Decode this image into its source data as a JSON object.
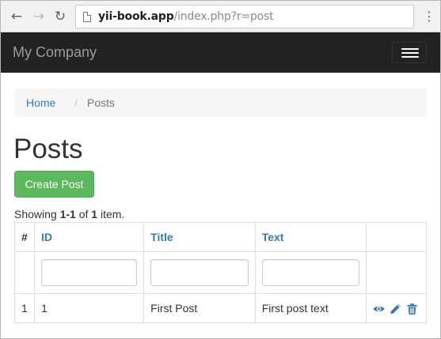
{
  "browser": {
    "url_host": "yii-book.app",
    "url_path": "/index.php?r=post",
    "back_icon": "arrow-left-icon",
    "forward_icon": "arrow-right-icon",
    "reload_icon": "reload-icon",
    "menu_icon": "kebab-menu-icon"
  },
  "navbar": {
    "brand": "My Company",
    "toggle_icon": "hamburger-menu-icon"
  },
  "breadcrumb": {
    "home": "Home",
    "separator": "/",
    "current": "Posts"
  },
  "page": {
    "title": "Posts",
    "create_button": "Create Post"
  },
  "summary": {
    "prefix": "Showing ",
    "range": "1-1",
    "middle": " of ",
    "total": "1",
    "suffix": " item."
  },
  "grid": {
    "columns": [
      "#",
      "ID",
      "Title",
      "Text"
    ],
    "filters": [
      {
        "value": "",
        "placeholder": ""
      },
      {
        "value": "",
        "placeholder": ""
      },
      {
        "value": "",
        "placeholder": ""
      }
    ],
    "rows": [
      {
        "serial": "1",
        "id": "1",
        "title": "First Post",
        "text": "First post text"
      }
    ],
    "action_icons": [
      "eye-icon",
      "pencil-icon",
      "trash-icon"
    ],
    "link_color": "#337ab7"
  },
  "colors": {
    "navbar_bg": "#222222",
    "success": "#5cb85c",
    "link": "#337ab7"
  }
}
